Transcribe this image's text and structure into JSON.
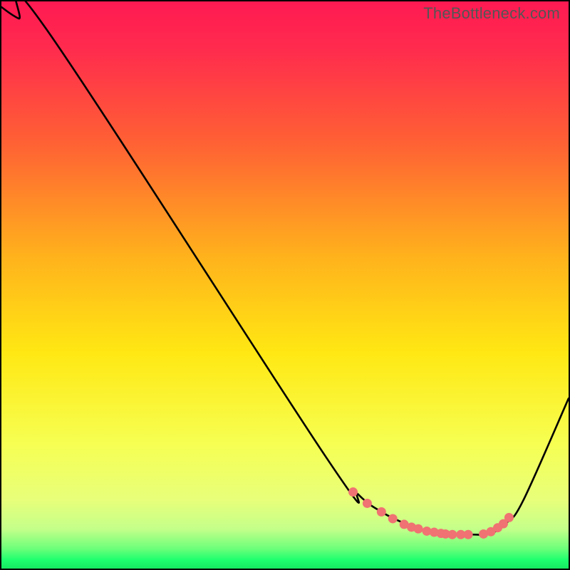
{
  "watermark": "TheBottleneck.com",
  "colors": {
    "top": "#ff1a52",
    "mid_upper": "#ff7a2e",
    "mid": "#ffe813",
    "mid_lower": "#f7ff5e",
    "green": "#1dff6e",
    "curve": "#000000",
    "dot": "#f07272",
    "border": "#000000"
  },
  "chart_data": {
    "type": "line",
    "title": "",
    "xlabel": "",
    "ylabel": "",
    "xlim": [
      0,
      100
    ],
    "ylim": [
      0,
      100
    ],
    "series": [
      {
        "name": "bottleneck-curve",
        "x": [
          0,
          3,
          8,
          57,
          63,
          67,
          71,
          75,
          79,
          83,
          85,
          87,
          89,
          92,
          100
        ],
        "y": [
          99,
          97,
          95,
          20,
          13,
          10,
          8,
          6.5,
          6,
          6,
          6,
          6.5,
          8,
          12,
          30
        ]
      }
    ],
    "dots": {
      "name": "highlighted-points",
      "x": [
        62,
        64.5,
        67,
        69,
        71,
        72.3,
        73.5,
        75,
        76.3,
        77.5,
        78.3,
        79.5,
        81,
        82.3,
        85,
        86.3,
        87.5,
        88.5,
        89.5
      ],
      "y": [
        13.5,
        11.5,
        10,
        8.8,
        7.8,
        7.3,
        7,
        6.6,
        6.4,
        6.2,
        6.1,
        6,
        6,
        6,
        6.1,
        6.5,
        7.2,
        7.9,
        9
      ]
    },
    "green_band_y": 4.5,
    "gradient_stops": [
      {
        "pos": 0.0,
        "color": "#ff1a52"
      },
      {
        "pos": 0.08,
        "color": "#ff2a4e"
      },
      {
        "pos": 0.25,
        "color": "#ff6134"
      },
      {
        "pos": 0.45,
        "color": "#ffb21c"
      },
      {
        "pos": 0.62,
        "color": "#ffe813"
      },
      {
        "pos": 0.78,
        "color": "#f6ff52"
      },
      {
        "pos": 0.88,
        "color": "#e7ff7a"
      },
      {
        "pos": 0.93,
        "color": "#c4ff8a"
      },
      {
        "pos": 0.965,
        "color": "#6cff7a"
      },
      {
        "pos": 0.985,
        "color": "#1dff6e"
      },
      {
        "pos": 1.0,
        "color": "#16e860"
      }
    ]
  }
}
